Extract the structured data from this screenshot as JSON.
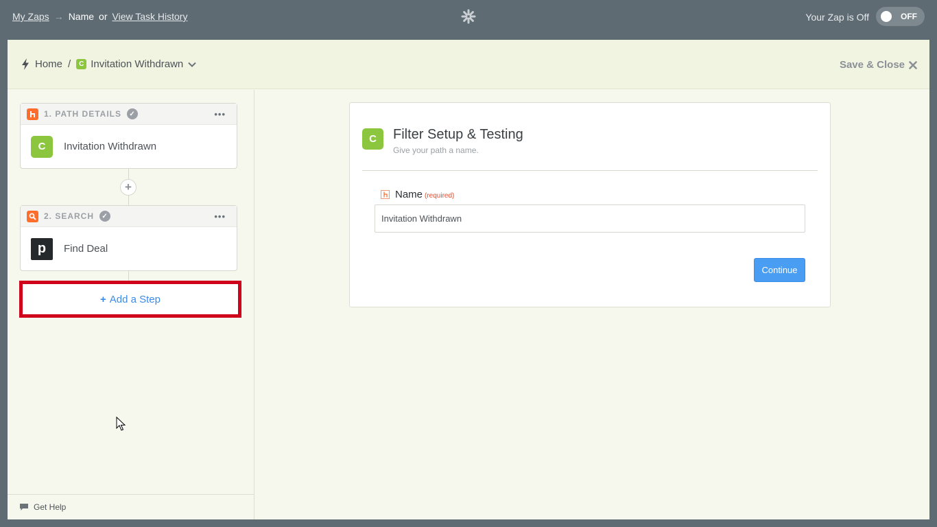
{
  "topbar": {
    "my_zaps": "My Zaps",
    "arrow": "→",
    "name": "Name",
    "or": "or",
    "task_history": "View Task History",
    "zap_status": "Your Zap is Off",
    "toggle_label": "OFF"
  },
  "subheader": {
    "home": "Home",
    "separator": "/",
    "app_letter": "C",
    "zap_name": "Invitation Withdrawn",
    "save_close": "Save & Close"
  },
  "steps": [
    {
      "header": "1. PATH DETAILS",
      "icon": "path-icon",
      "app_letter": "C",
      "label": "Invitation Withdrawn",
      "app_color": "#8cc63f"
    },
    {
      "header": "2. SEARCH",
      "icon": "search-icon",
      "app_letter": "p",
      "label": "Find Deal",
      "app_color": "#26292c"
    }
  ],
  "add_step": "Add a Step",
  "get_help": "Get Help",
  "panel": {
    "app_letter": "C",
    "title": "Filter Setup & Testing",
    "subtitle": "Give your path a name.",
    "field_label": "Name",
    "field_required": "(required)",
    "field_value": "Invitation Withdrawn",
    "continue": "Continue"
  },
  "colors": {
    "accent": "#499df3",
    "highlight": "#d0021b",
    "zapier_orange": "#ff6d2c",
    "app_green": "#8cc63f"
  }
}
